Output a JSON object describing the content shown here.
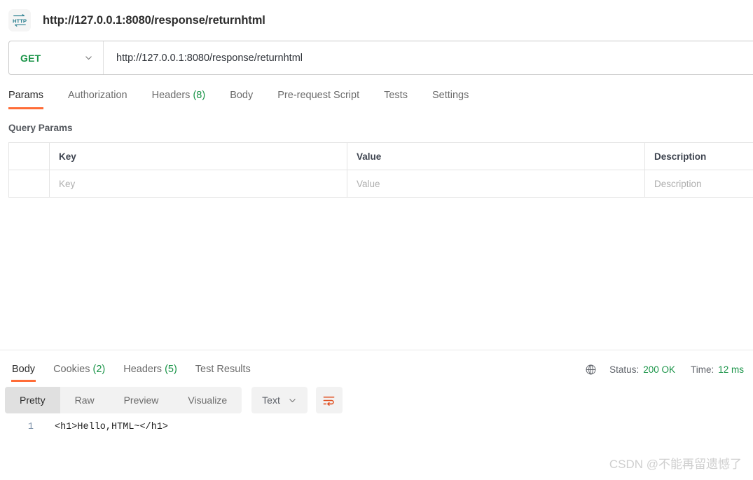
{
  "request": {
    "protocol_icon": "http-icon",
    "title": "http://127.0.0.1:8080/response/returnhtml",
    "method": "GET",
    "url": "http://127.0.0.1:8080/response/returnhtml",
    "tabs": [
      {
        "label": "Params",
        "active": true
      },
      {
        "label": "Authorization",
        "active": false
      },
      {
        "label": "Headers",
        "count": "(8)",
        "active": false
      },
      {
        "label": "Body",
        "active": false
      },
      {
        "label": "Pre-request Script",
        "active": false
      },
      {
        "label": "Tests",
        "active": false
      },
      {
        "label": "Settings",
        "active": false
      }
    ]
  },
  "query_params": {
    "section_title": "Query Params",
    "headers": [
      "",
      "Key",
      "Value",
      "Description"
    ],
    "rows": [
      {
        "key": "Key",
        "value": "Value",
        "description": "Description"
      }
    ]
  },
  "response": {
    "tabs": [
      {
        "label": "Body",
        "active": true
      },
      {
        "label": "Cookies",
        "count": "(2)",
        "active": false
      },
      {
        "label": "Headers",
        "count": "(5)",
        "active": false
      },
      {
        "label": "Test Results",
        "active": false
      }
    ],
    "status_label": "Status:",
    "status_value": "200 OK",
    "time_label": "Time:",
    "time_value": "12 ms",
    "globe_icon": "globe-icon",
    "view_modes": [
      {
        "label": "Pretty",
        "active": true
      },
      {
        "label": "Raw",
        "active": false
      },
      {
        "label": "Preview",
        "active": false
      },
      {
        "label": "Visualize",
        "active": false
      }
    ],
    "format": "Text",
    "wrap_icon": "word-wrap-icon",
    "code_lines": [
      {
        "number": "1",
        "text": "<h1>Hello,HTML~</h1>"
      }
    ]
  },
  "watermark": "CSDN @不能再留遗憾了",
  "colors": {
    "accent": "#ff6c37",
    "success": "#1a9448",
    "icon_teal": "#2a7f8f"
  }
}
